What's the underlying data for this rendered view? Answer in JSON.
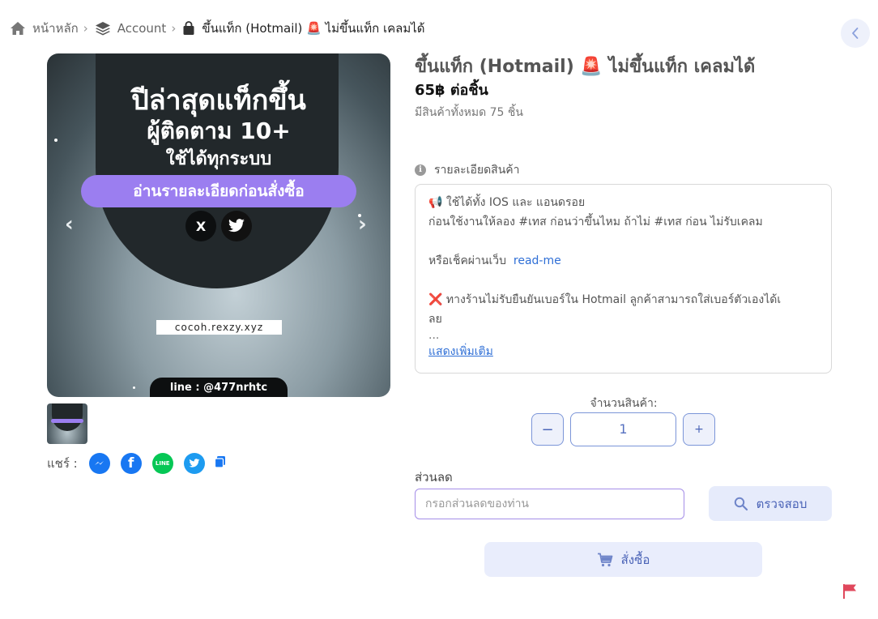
{
  "breadcrumb": {
    "home": "หน้าหลัก",
    "category": "Account",
    "current": "ขึ้นแท็ก (Hotmail) 🚨 ไม่ขึ้นแท็ก เคลมได้"
  },
  "product": {
    "title": "ขึ้นแท็ก (Hotmail) 🚨 ไม่ขึ้นแท็ก เคลมได้",
    "price": "65฿ ต่อชิ้น",
    "stock": "มีสินค้าทั้งหมด 75 ชิ้น"
  },
  "hero_image": {
    "line1": "ปีล่าสุดแท็กขึ้น",
    "line2": "ผู้ติดตาม 10+",
    "line3": "ใช้ได้ทุกระบบ",
    "pill": "อ่านรายละเอียดก่อนสั่งซื้อ",
    "x_logo": "X",
    "url": "cocoh.rexzy.xyz",
    "line_id": "line : @477nrhtc"
  },
  "share": {
    "label": "แชร์ :",
    "line_text": "LINE"
  },
  "details": {
    "heading": "รายละเอียดสินค้า",
    "line1": "📢 ใช้ได้ทั้ง IOS และ แอนดรอย",
    "line2": "ก่อนใช้งานให้ลอง #เทส ก่อนว่าขึ้นไหม ถ้าไม่ #เทส ก่อน ไม่รับเคลม",
    "line3_prefix": "หรือเช็คผ่านเว็บ",
    "line3_link": "read-me",
    "line4": "❌ ทางร้านไม่รับยืนยันเบอร์ใน Hotmail ลูกค้าสามารถใส่เบอร์ตัวเองได้เ",
    "line5": "ลย",
    "ellipsis": "...",
    "show_more": "แสดงเพิ่มเติม"
  },
  "quantity": {
    "label": "จำนวนสินค้า:",
    "minus": "−",
    "value": "1",
    "plus": "+"
  },
  "discount": {
    "label": "ส่วนลด",
    "placeholder": "กรอกส่วนลดของท่าน",
    "check_label": "ตรวจสอบ"
  },
  "order": {
    "label": "สั่งซื้อ"
  },
  "colors": {
    "accent": "#4a63b7",
    "button_bg": "#e6ebfb",
    "purple_pill": "#9b7ef0",
    "report_flag": "#e0485c"
  }
}
